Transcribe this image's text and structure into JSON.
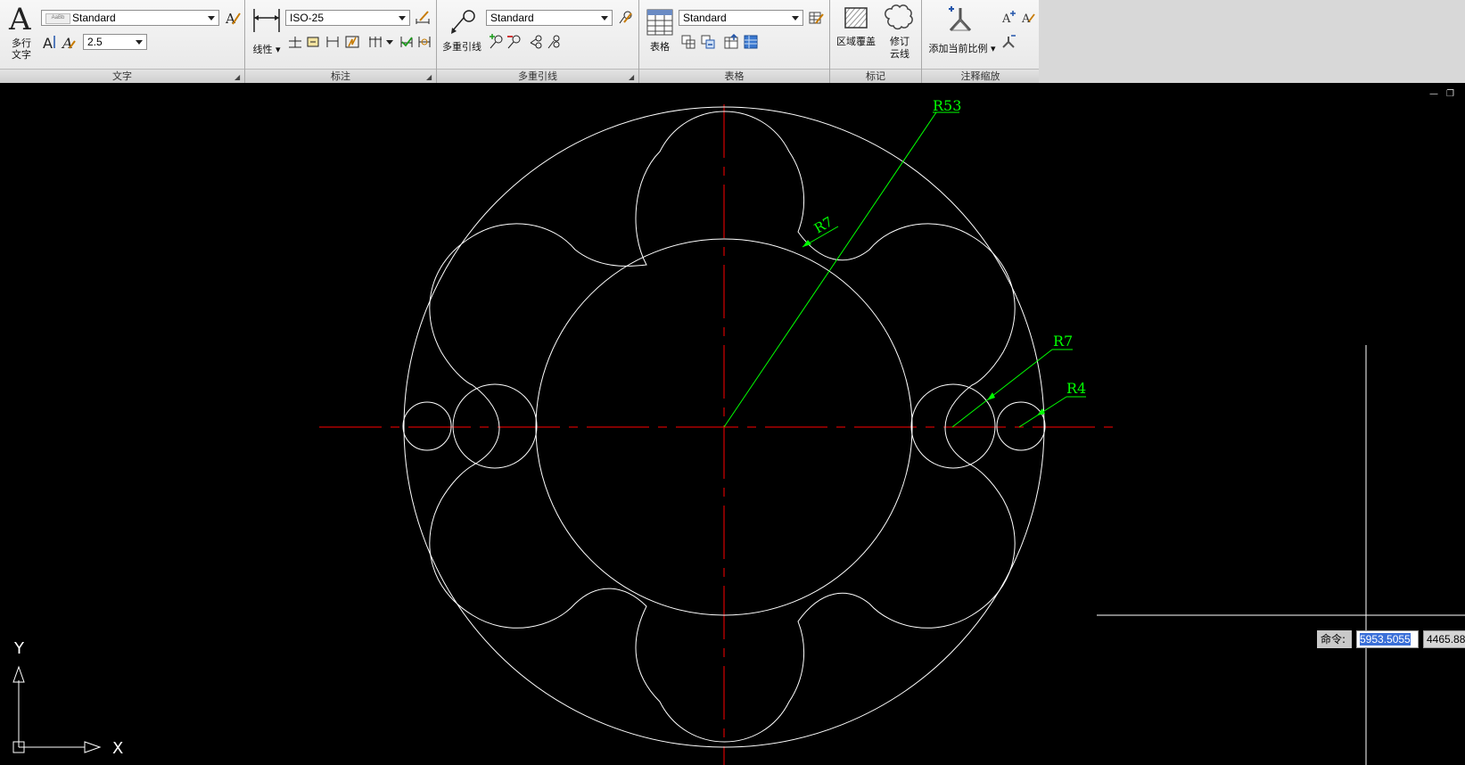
{
  "ribbon": {
    "text_panel": {
      "title": "文字",
      "mtext_label_1": "多行",
      "mtext_label_2": "文字",
      "style_value": "Standard",
      "height_value": "2.5"
    },
    "dim_panel": {
      "title": "标注",
      "linear_label": "线性",
      "style_value": "ISO-25"
    },
    "mleader_panel": {
      "title": "多重引线",
      "mleader_label": "多重引线",
      "style_value": "Standard"
    },
    "table_panel": {
      "title": "表格",
      "table_label": "表格",
      "style_value": "Standard"
    },
    "markup_panel": {
      "title": "标记",
      "wipeout_label": "区域覆盖",
      "revcloud_label_1": "修订",
      "revcloud_label_2": "云线"
    },
    "annoscale_panel": {
      "title": "注释缩放",
      "add_scale_label": "添加当前比例"
    }
  },
  "drawing": {
    "dimensions": {
      "outer_radius": "R53",
      "inner_lobe_radius": "R7",
      "right_hole_radius": "R7",
      "small_hole_radius": "R4"
    },
    "ucs": {
      "x_label": "X",
      "y_label": "Y"
    },
    "colors": {
      "geometry": "#ffffff",
      "centerline": "#ff0000",
      "dimension": "#00ff00",
      "background": "#000000"
    }
  },
  "command": {
    "label": "命令:",
    "x_value": "5953.5055",
    "y_value": "4465.88"
  }
}
